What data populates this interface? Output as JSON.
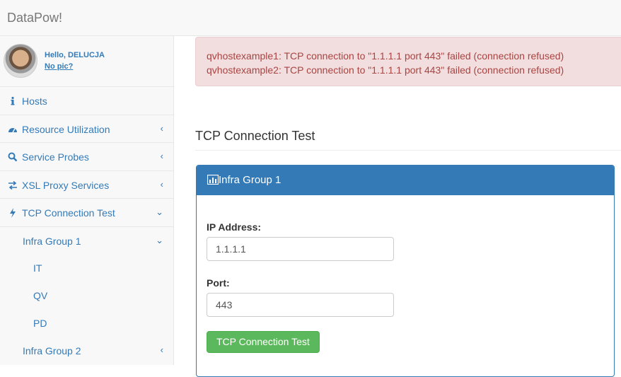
{
  "app": {
    "brand": "DataPow!"
  },
  "user": {
    "greeting": "Hello, DELUCJA",
    "no_pic_link": "No pic?"
  },
  "sidebar": {
    "items": [
      {
        "label": "Hosts",
        "icon": "info-icon"
      },
      {
        "label": "Resource Utilization",
        "icon": "dashboard-icon",
        "arrow": "‹"
      },
      {
        "label": "Service Probes",
        "icon": "search-icon",
        "arrow": "‹"
      },
      {
        "label": "XSL Proxy Services",
        "icon": "exchange-icon",
        "arrow": "‹"
      },
      {
        "label": "TCP Connection Test",
        "icon": "bolt-icon",
        "arrow": "⌄"
      }
    ],
    "groups": [
      {
        "label": "Infra Group 1",
        "arrow": "⌄",
        "children": [
          "IT",
          "QV",
          "PD"
        ]
      },
      {
        "label": "Infra Group 2",
        "arrow": "‹"
      }
    ]
  },
  "alert": {
    "lines": [
      "qvhostexample1: TCP connection to \"1.1.1.1 port 443\" failed (connection refused)",
      "qvhostexample2: TCP connection to \"1.1.1.1 port 443\" failed (connection refused)"
    ]
  },
  "page": {
    "title": "TCP Connection Test"
  },
  "panel": {
    "heading": "Infra Group 1",
    "icon": "bar-chart-icon",
    "ip_label": "IP Address:",
    "ip_value": "1.1.1.1",
    "port_label": "Port:",
    "port_value": "443",
    "submit_label": "TCP Connection Test"
  },
  "colors": {
    "link": "#337ab7",
    "alert_bg": "#f2dede",
    "alert_text": "#a94442",
    "button": "#5cb85c"
  }
}
